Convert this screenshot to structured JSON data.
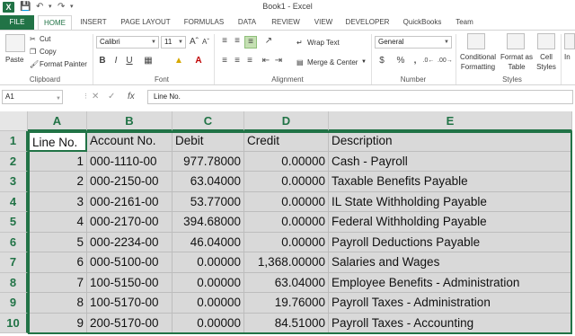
{
  "window": {
    "title": "Book1 - Excel",
    "app_icon": "X"
  },
  "tabs": [
    "FILE",
    "HOME",
    "INSERT",
    "PAGE LAYOUT",
    "FORMULAS",
    "DATA",
    "REVIEW",
    "VIEW",
    "DEVELOPER",
    "QuickBooks",
    "Team"
  ],
  "ribbon": {
    "clipboard": {
      "paste": "Paste",
      "cut": "Cut",
      "copy": "Copy",
      "format_painter": "Format Painter",
      "label": "Clipboard"
    },
    "font": {
      "name": "Calibri",
      "size": "11",
      "bold": "B",
      "italic": "I",
      "underline": "U",
      "label": "Font"
    },
    "alignment": {
      "wrap_text": "Wrap Text",
      "merge_center": "Merge & Center",
      "label": "Alignment"
    },
    "number": {
      "format": "General",
      "currency": "$",
      "percent": "%",
      "comma": ",",
      "label": "Number"
    },
    "styles": {
      "conditional_line1": "Conditional",
      "conditional_line2": "Formatting",
      "format_table_line1": "Format as",
      "format_table_line2": "Table",
      "cell_styles_line1": "Cell",
      "cell_styles_line2": "Styles",
      "label": "Styles"
    },
    "cells": {
      "insert": "In"
    }
  },
  "formula_bar": {
    "name_box": "A1",
    "fx": "fx",
    "content": "Line No."
  },
  "sheet": {
    "columns": [
      "A",
      "B",
      "C",
      "D",
      "E"
    ],
    "rows": [
      "1",
      "2",
      "3",
      "4",
      "5",
      "6",
      "7",
      "8",
      "9",
      "10"
    ],
    "cells": [
      [
        "Line No.",
        "Account No.",
        "Debit",
        "Credit",
        "Description"
      ],
      [
        "1",
        "000-1110-00",
        "977.78000",
        "0.00000",
        "Cash - Payroll"
      ],
      [
        "2",
        "000-2150-00",
        "63.04000",
        "0.00000",
        "Taxable Benefits Payable"
      ],
      [
        "3",
        "000-2161-00",
        "53.77000",
        "0.00000",
        "IL State Withholding Payable"
      ],
      [
        "4",
        "000-2170-00",
        "394.68000",
        "0.00000",
        "Federal Withholding Payable"
      ],
      [
        "5",
        "000-2234-00",
        "46.04000",
        "0.00000",
        "Payroll Deductions Payable"
      ],
      [
        "6",
        "000-5100-00",
        "0.00000",
        "1,368.00000",
        "Salaries and Wages"
      ],
      [
        "7",
        "100-5150-00",
        "0.00000",
        "63.04000",
        "Employee Benefits - Administration"
      ],
      [
        "8",
        "100-5170-00",
        "0.00000",
        "19.76000",
        "Payroll Taxes - Administration"
      ],
      [
        "9",
        "200-5170-00",
        "0.00000",
        "84.51000",
        "Payroll Taxes - Accounting"
      ]
    ]
  },
  "colors": {
    "accent": "#217346",
    "selection": "#d9d9d9"
  }
}
